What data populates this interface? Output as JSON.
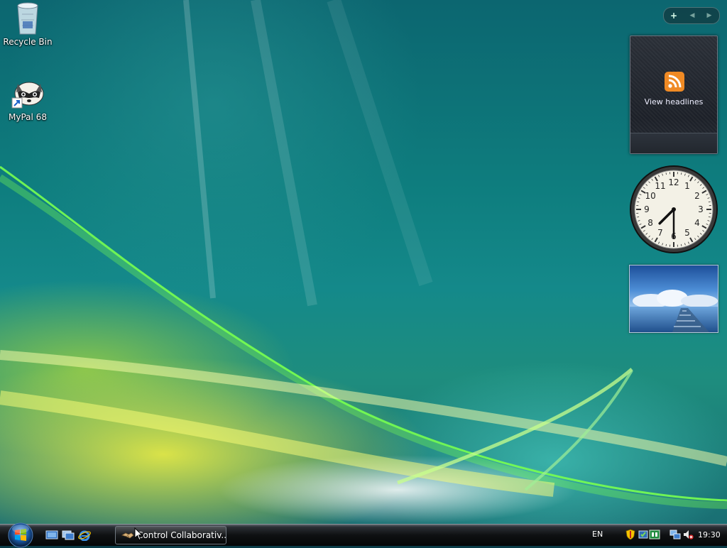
{
  "desktop": {
    "icons": [
      {
        "label": "Recycle Bin",
        "icon": "recycle-bin-icon"
      },
      {
        "label": "MyPal 68",
        "icon": "raccoon-shortcut-icon"
      }
    ]
  },
  "sidebar": {
    "toolbar_add": "+",
    "toolbar_prev": "◀",
    "toolbar_next": "▶",
    "feed_gadget": {
      "label": "View headlines",
      "icon": "rss-icon"
    },
    "clock_gadget": {
      "numbers": [
        "12",
        "1",
        "2",
        "3",
        "4",
        "5",
        "6",
        "7",
        "8",
        "9",
        "10",
        "11"
      ],
      "hour": 7,
      "minute": 30
    },
    "slideshow_gadget": {
      "icon": "landscape-photo"
    }
  },
  "taskbar": {
    "start_icon": "windows-orb-icon",
    "quick_launch": [
      "show-desktop-icon",
      "switch-windows-icon",
      "internet-explorer-icon"
    ],
    "tasks": [
      {
        "label": "Control Collaborativ...",
        "icon": "handshake-icon"
      }
    ],
    "language": "EN",
    "tray_icons": [
      "security-shield-icon",
      "update-icon",
      "network-icon",
      "volume-muted-icon"
    ],
    "time": "19:30"
  },
  "colors": {
    "desktop_teal": "#0e7d7e",
    "desktop_yellow": "#e4e846",
    "taskbar_black": "#0e1012",
    "rss_orange": "#f08a24"
  }
}
